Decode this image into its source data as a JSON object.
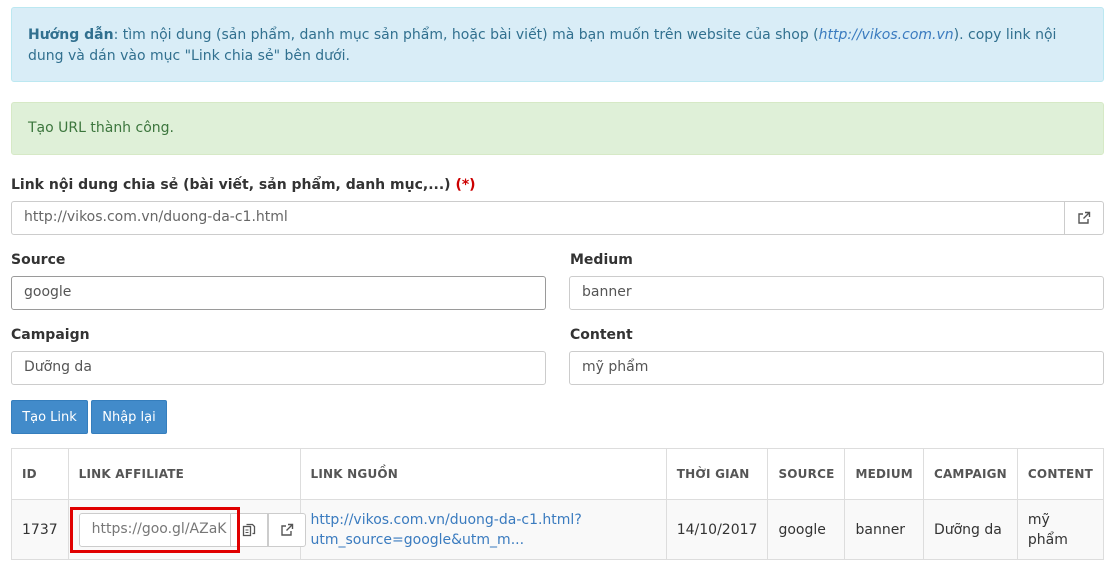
{
  "guide": {
    "title": "Hướng dẫn",
    "text_before": ": tìm nội dung (sản phẩm, danh mục sản phẩm, hoặc bài viết) mà bạn muốn trên website của shop (",
    "shop_url": "http://vikos.com.vn",
    "text_after": "). copy link nội dung và dán vào mục \"Link chia sẻ\" bên dưới."
  },
  "success_message": "Tạo URL thành công.",
  "form": {
    "link_label": "Link nội dung chia sẻ (bài viết, sản phẩm, danh mục,...)",
    "required_mark": "(*)",
    "link_value": "http://vikos.com.vn/duong-da-c1.html",
    "source_label": "Source",
    "source_value": "google",
    "medium_label": "Medium",
    "medium_value": "banner",
    "campaign_label": "Campaign",
    "campaign_value": "Dưỡng da",
    "content_label": "Content",
    "content_value": "mỹ phẩm",
    "create_button": "Tạo Link",
    "reset_button": "Nhập lại"
  },
  "table": {
    "headers": [
      "ID",
      "LINK AFFILIATE",
      "LINK NGUỒN",
      "THỜI GIAN",
      "SOURCE",
      "MEDIUM",
      "CAMPAIGN",
      "CONTENT"
    ],
    "rows": [
      {
        "id": "1737",
        "affiliate_link": "https://goo.gl/AZaK",
        "source_link_line1": "http://vikos.com.vn/duong-da-c1.html?",
        "source_link_line2": "utm_source=google&utm_m...",
        "time": "14/10/2017",
        "source": "google",
        "medium": "banner",
        "campaign": "Dưỡng da",
        "content": "mỹ phẩm"
      }
    ]
  },
  "icons": {
    "external_link": "external-link-icon",
    "copy": "copy-icon"
  },
  "colors": {
    "primary": "#428bca",
    "info_bg": "#d9edf7",
    "success_bg": "#dff0d8",
    "highlight": "#e00000"
  }
}
